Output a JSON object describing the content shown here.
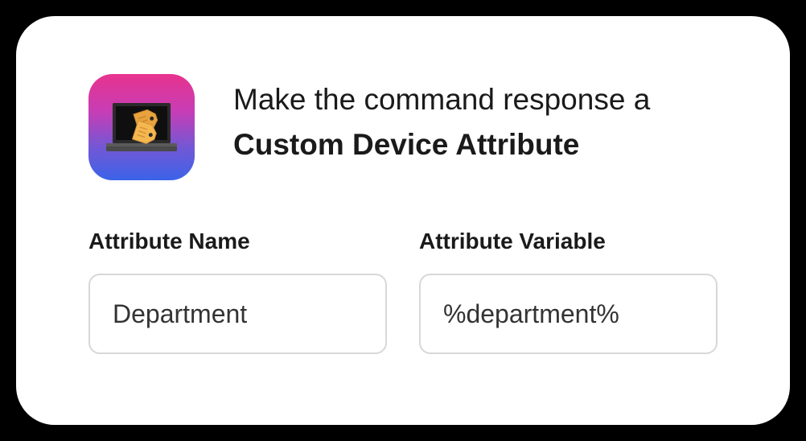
{
  "header": {
    "line1": "Make the command response a",
    "line2": "Custom Device Attribute"
  },
  "fields": {
    "attributeName": {
      "label": "Attribute Name",
      "value": "Department"
    },
    "attributeVariable": {
      "label": "Attribute Variable",
      "value": "%department%"
    }
  }
}
